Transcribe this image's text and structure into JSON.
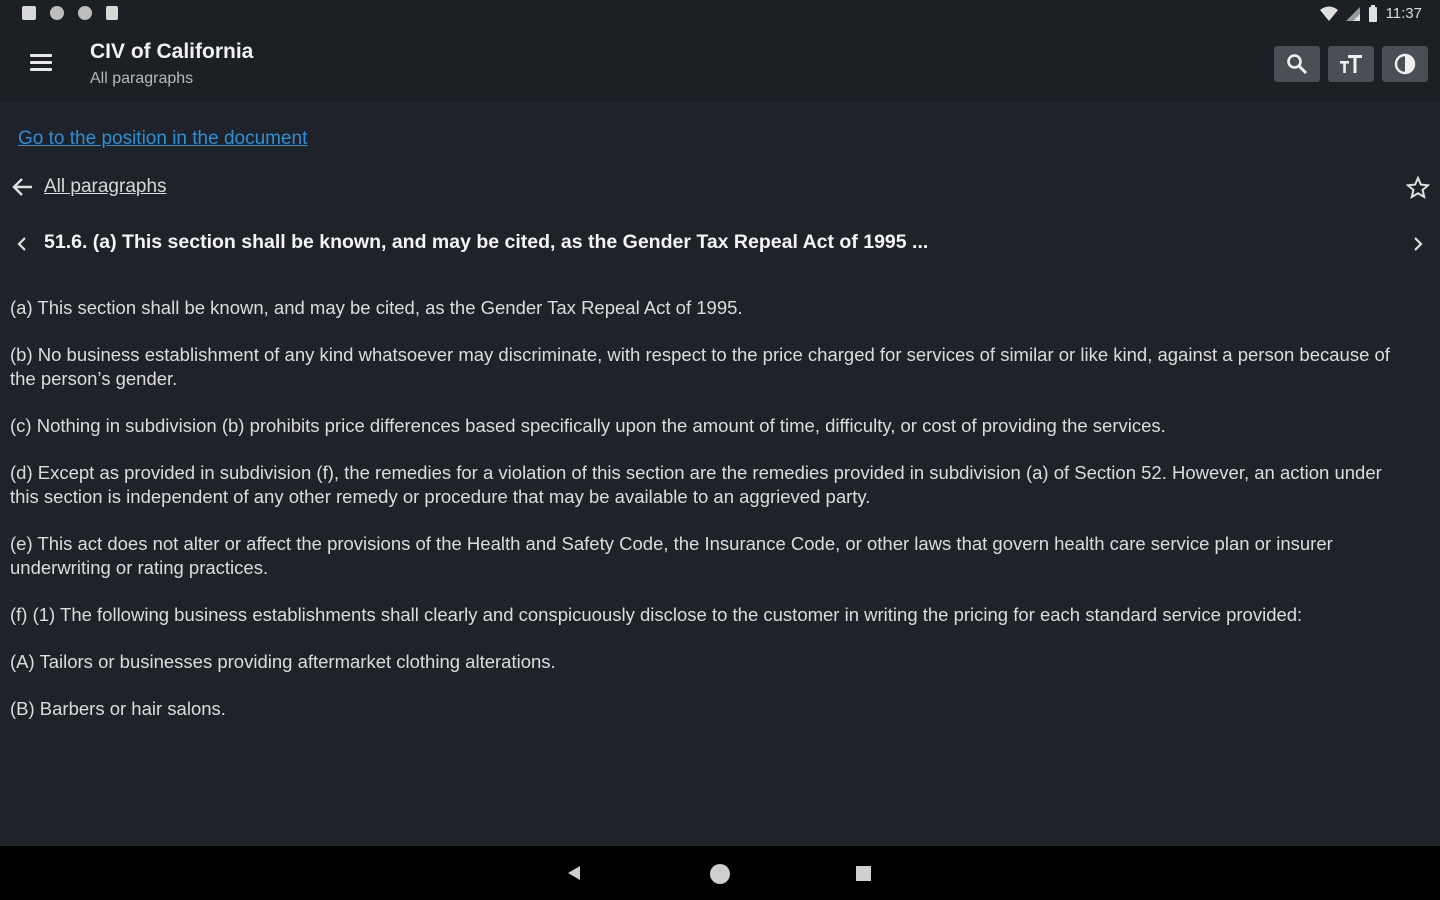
{
  "status_bar": {
    "time": "11:37",
    "icons": [
      "notification-square-icon",
      "circle-icon",
      "circle-icon",
      "sd-card-icon",
      "wifi-icon",
      "signal-icon",
      "battery-icon"
    ]
  },
  "app_bar": {
    "title": "CIV of California",
    "subtitle": "All paragraphs",
    "actions": [
      "search-icon",
      "text-size-icon",
      "contrast-icon"
    ]
  },
  "content": {
    "goto_link": "Go to the position in the document",
    "back_label": "All paragraphs",
    "section_title": "51.6. (a) This section shall be known, and may be cited, as the Gender Tax Repeal Act of 1995 ...",
    "paragraphs": [
      "(a) This section shall be known, and may be cited, as the Gender Tax Repeal Act of 1995.",
      "(b) No business establishment of any kind whatsoever may discriminate, with respect to the price charged for services of similar or like kind, against a person because of the person’s gender.",
      "(c) Nothing in subdivision (b) prohibits price differences based specifically upon the amount of time, difficulty, or cost of providing the services.",
      "(d) Except as provided in subdivision (f), the remedies for a violation of this section are the remedies provided in subdivision (a) of Section 52. However, an action under this section is independent of any other remedy or procedure that may be available to an aggrieved party.",
      "(e) This act does not alter or affect the provisions of the Health and Safety Code, the Insurance Code, or other laws that govern health care service plan or insurer underwriting or rating practices.",
      "(f) (1) The following business establishments shall clearly and conspicuously disclose to the customer in writing the pricing for each standard service provided:",
      "(A) Tailors or businesses providing aftermarket clothing alterations.",
      "(B) Barbers or hair salons."
    ]
  },
  "colors": {
    "background": "#1f2329",
    "link": "#2f8fd6",
    "button": "#4a4e55"
  }
}
